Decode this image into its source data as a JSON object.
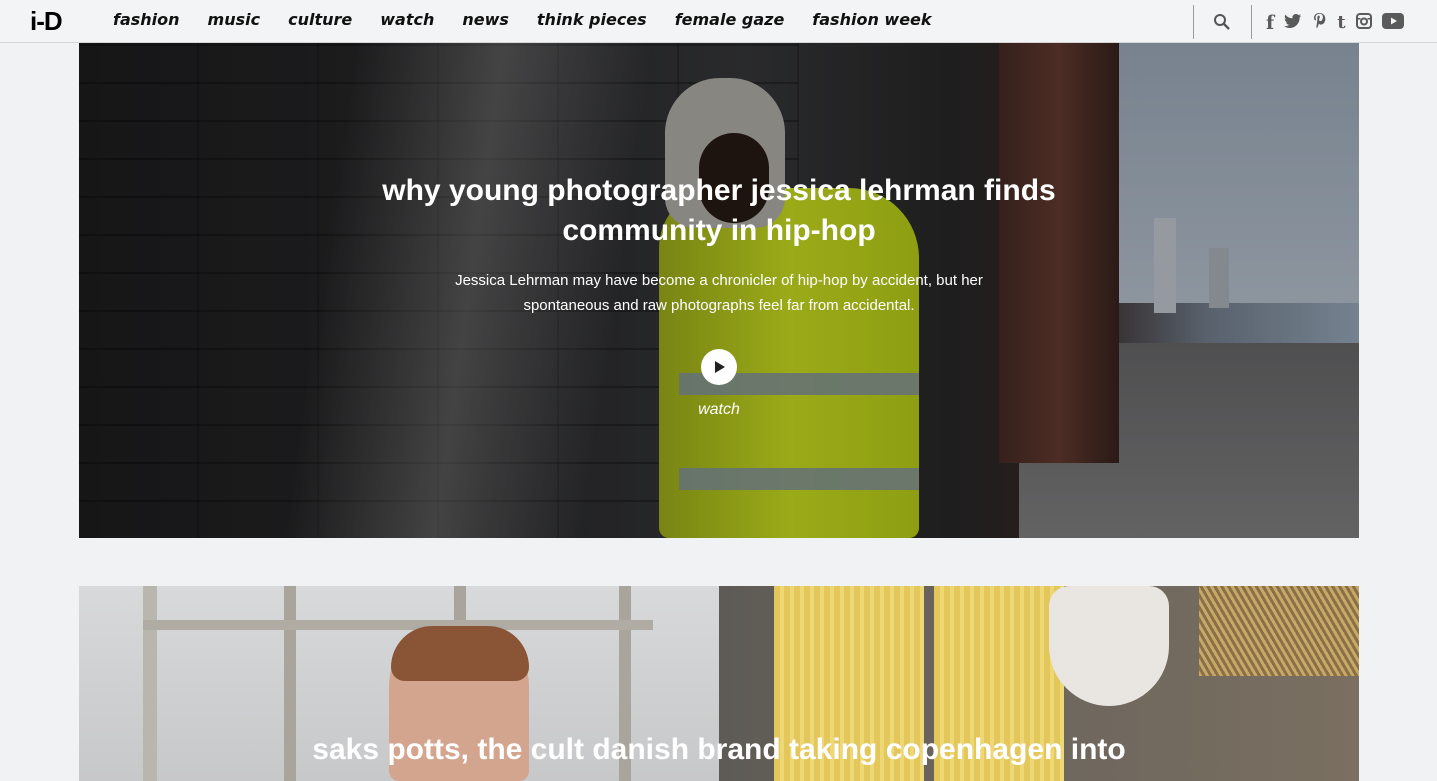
{
  "header": {
    "logo": "i-D",
    "nav": [
      "fashion",
      "music",
      "culture",
      "watch",
      "news",
      "think pieces",
      "female gaze",
      "fashion week"
    ],
    "social": [
      "f",
      "t"
    ]
  },
  "hero": {
    "title": "why young photographer jessica lehrman finds community in hip-hop",
    "subtitle": "Jessica Lehrman may have become a chronicler of hip-hop by accident, but her spontaneous and raw photographs feel far from accidental.",
    "watch_label": "watch"
  },
  "card2": {
    "title": "saks potts, the cult danish brand taking copenhagen into"
  }
}
